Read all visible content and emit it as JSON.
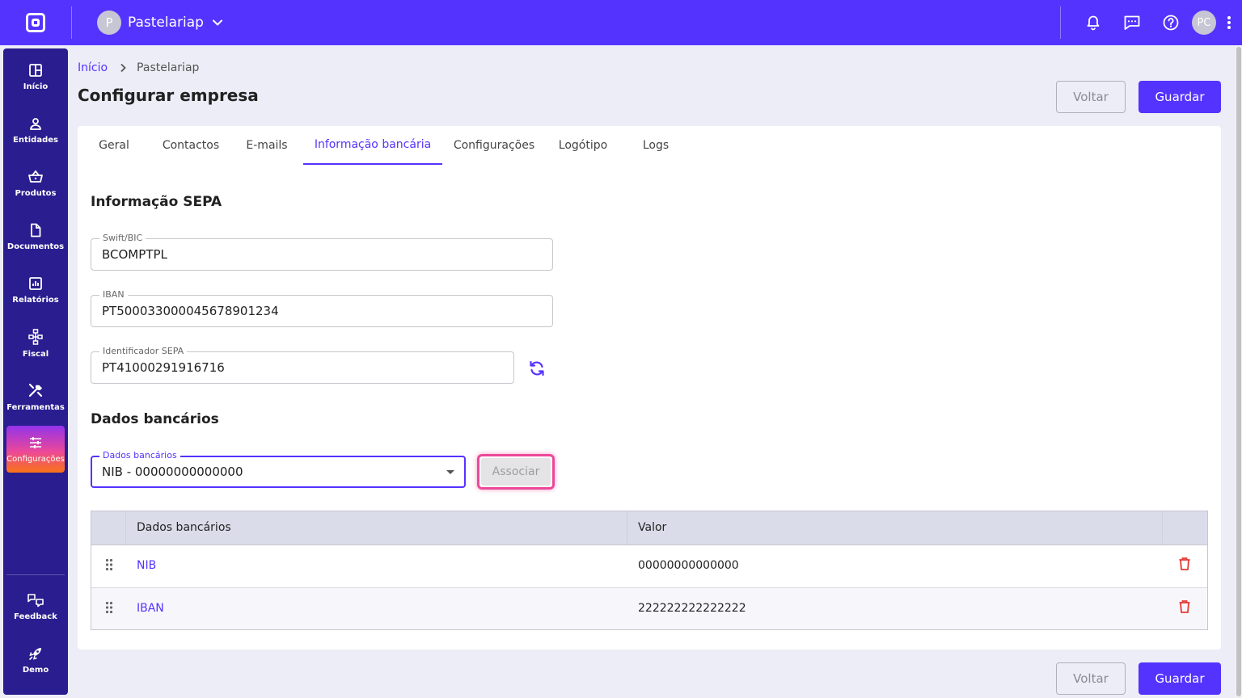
{
  "topbar": {
    "company_initial": "P",
    "company_name": "Pastelariap",
    "user_initials": "PC"
  },
  "sidebar": {
    "items": [
      {
        "label": "Início",
        "icon": "dashboard-icon"
      },
      {
        "label": "Entidades",
        "icon": "person-icon"
      },
      {
        "label": "Produtos",
        "icon": "basket-icon"
      },
      {
        "label": "Documentos",
        "icon": "document-icon"
      },
      {
        "label": "Relatórios",
        "icon": "chart-icon"
      },
      {
        "label": "Fiscal",
        "icon": "hierarchy-icon"
      },
      {
        "label": "Ferramentas",
        "icon": "tools-icon"
      },
      {
        "label": "Configurações",
        "icon": "sliders-icon"
      }
    ],
    "bottom": [
      {
        "label": "Feedback",
        "icon": "feedback-icon"
      },
      {
        "label": "Demo",
        "icon": "rocket-icon"
      }
    ]
  },
  "breadcrumb": {
    "home": "Início",
    "current": "Pastelariap"
  },
  "page": {
    "title": "Configurar empresa",
    "back_label": "Voltar",
    "save_label": "Guardar"
  },
  "tabs": [
    "Geral",
    "Contactos",
    "E-mails",
    "Informação bancária",
    "Configurações",
    "Logótipo",
    "Logs"
  ],
  "active_tab": "Informação bancária",
  "sepa": {
    "title": "Informação SEPA",
    "swift_label": "Swift/BIC",
    "swift_value": "BCOMPTPL",
    "iban_label": "IBAN",
    "iban_value": "PT50003300004567890123 4",
    "identifier_label": "Identificador SEPA",
    "identifier_value": "PT41000291916716"
  },
  "bank": {
    "title": "Dados bancários",
    "select_label": "Dados bancários",
    "select_value": "NIB - 00000000000000",
    "associate_label": "Associar",
    "table": {
      "headers": [
        "Dados bancários",
        "Valor"
      ],
      "rows": [
        {
          "name": "NIB",
          "value": "00000000000000"
        },
        {
          "name": "IBAN",
          "value": "222222222222222"
        }
      ]
    }
  },
  "colors": {
    "primary": "#5533ff",
    "sidebar": "#2a1d8f",
    "danger": "#e53935",
    "highlight": "#ec4899"
  }
}
